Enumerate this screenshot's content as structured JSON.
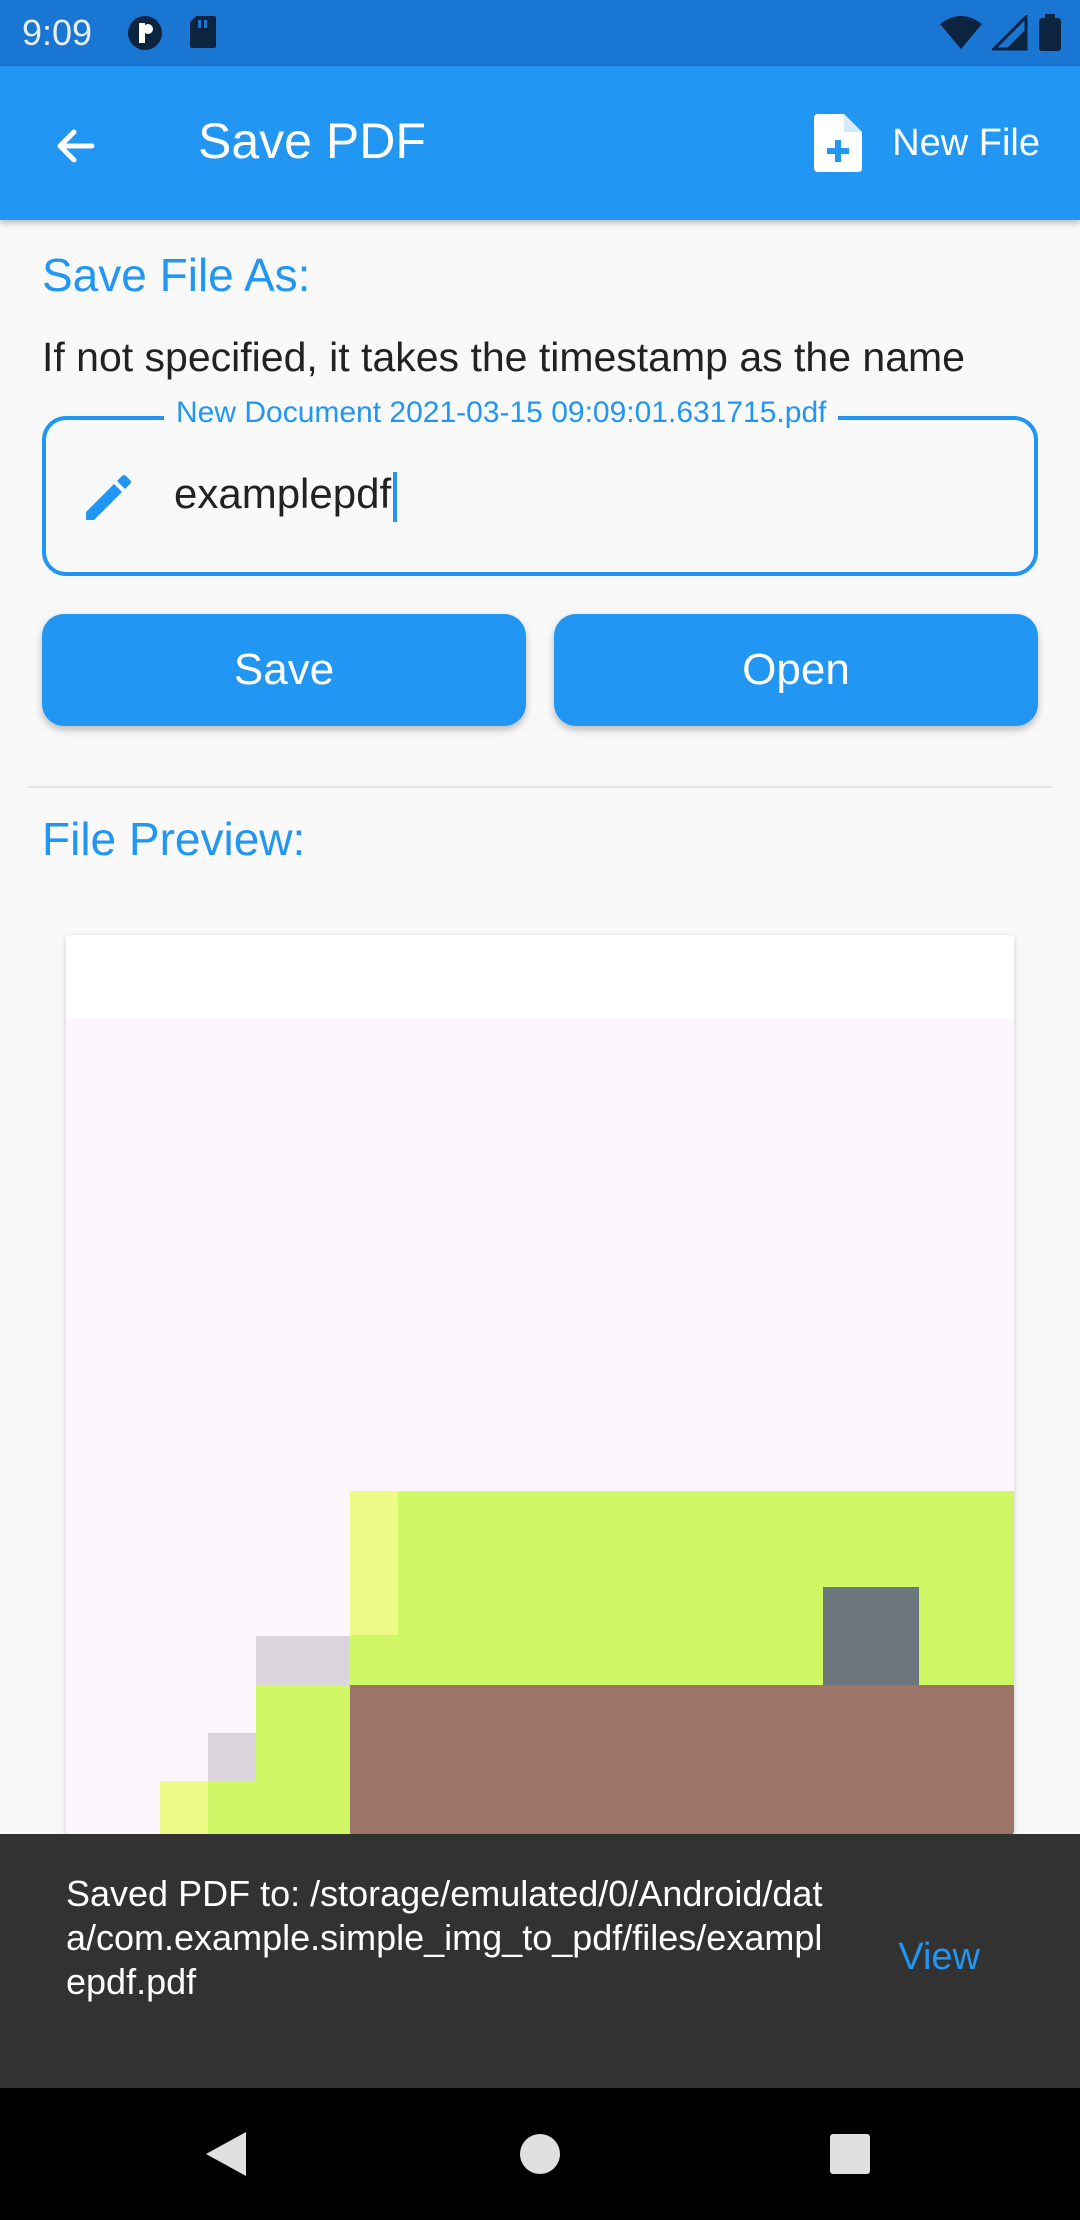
{
  "status_bar": {
    "time": "9:09"
  },
  "app_bar": {
    "title": "Save PDF",
    "new_file_label": "New File"
  },
  "save_section": {
    "title": "Save File As:",
    "helper": "If not specified, it takes the timestamp as the name",
    "input_label": "New Document 2021-03-15 09:09:01.631715.pdf",
    "input_value": "examplepdf"
  },
  "buttons": {
    "save": "Save",
    "open": "Open"
  },
  "preview_section": {
    "title": "File Preview:"
  },
  "snackbar": {
    "message": "Saved PDF to: /storage/emulated/0/Android/data/com.example.simple_img_to_pdf/files/examplepdf.pdf",
    "action": "View"
  },
  "colors": {
    "primary": "#2196f3",
    "status_bar": "#1976d2",
    "snackbar": "#323232"
  }
}
